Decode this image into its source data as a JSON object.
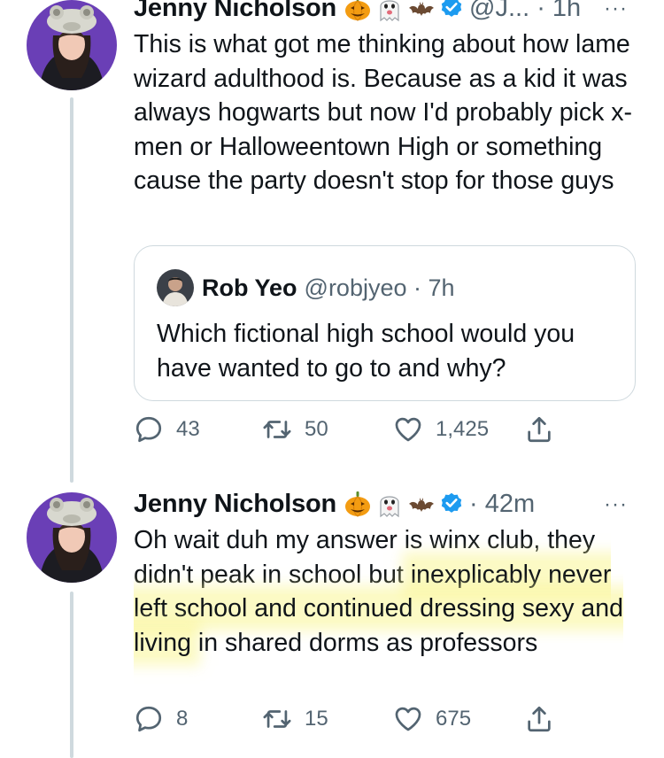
{
  "tweets": [
    {
      "display_name": "Jenny Nicholson",
      "emojis": [
        "jack-o-lantern",
        "ghost",
        "bat"
      ],
      "verified": true,
      "handle_time": "@J... · 1h",
      "more": "···",
      "text": "This is what got me thinking about how lame wizard adulthood is. Because as a kid it was always hogwarts but now I'd probably pick x-men or Halloweentown High or something cause the party doesn't stop for those guys",
      "quote": {
        "display_name": "Rob Yeo",
        "handle_time": "@robjyeo · 7h",
        "text": "Which fictional high school would you have wanted to go to and why?"
      },
      "actions": {
        "replies": "43",
        "retweets": "50",
        "likes": "1,425"
      }
    },
    {
      "display_name": "Jenny Nicholson",
      "emojis": [
        "jack-o-lantern",
        "ghost",
        "bat"
      ],
      "verified": true,
      "handle_time": "· 42m",
      "more": "···",
      "text_plain": "Oh wait duh my answer is winx club, they didn't peak in school but ",
      "text_highlight": "inexplicably never left school and continued dressing sexy and living",
      "text_tail": " in shared dorms as professors",
      "actions": {
        "replies": "8",
        "retweets": "15",
        "likes": "675"
      }
    }
  ],
  "colors": {
    "text": "#0f1419",
    "muted": "#536471",
    "verified": "#1d9bf0",
    "avatar_bg": "#6a3fb6",
    "thread_line": "#cfd9de",
    "highlight": "#faf596"
  }
}
